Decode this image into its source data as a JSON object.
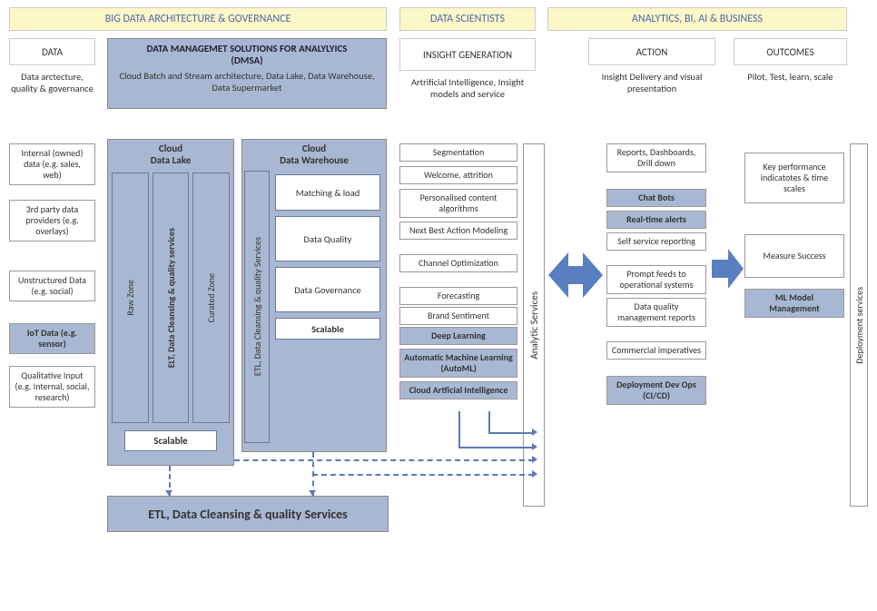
{
  "header": {
    "band1": "BIG DATA ARCHITECTURE & GOVERNANCE",
    "band2": "DATA SCIENTISTS",
    "band3": "ANALYTICS, BI, AI & BUSINESS"
  },
  "columns": {
    "data": {
      "title": "DATA",
      "subtitle": "Data arctecture, quality & governance"
    },
    "dmsa": {
      "title": "DATA MANAGEMET SOLUTIONS FOR ANALYLYICS\n(DMSA)",
      "subtitle": "Cloud Batch and Stream architecture, Data Lake, Data Warehouse, Data Supermarket"
    },
    "insight": {
      "title": "INSIGHT GENERATION",
      "subtitle": "Artrificial Intelligence, Insight models and service"
    },
    "action": {
      "title": "ACTION",
      "subtitle": "Insight Delivery and visual presentation"
    },
    "outcomes": {
      "title": "OUTCOMES",
      "subtitle": "Pilot, Test, learn, scale"
    }
  },
  "data_sources": [
    "Internal (owned) data (e.g. sales, web)",
    "3rd party data providers (e.g. overlays)",
    "Unstructured Data (e.g. social)",
    "IoT Data (e.g. sensor)",
    "Qualitative Input (e.g. Internal, social, research)"
  ],
  "cloud_data_lake": {
    "title": "Cloud\nData Lake",
    "raw_zone": "Raw Zone",
    "elt": "ELT, Data Cleansing & quality services",
    "curated": "Curated Zone",
    "scalable": "Scalable"
  },
  "cloud_dw": {
    "title": "Cloud\nData Warehouse",
    "etl": "ETL, Data Cleansing & quality Services",
    "box1": "Matching & load",
    "box2": "Data Quality",
    "box3": "Data Governance",
    "box4": "Scalable"
  },
  "insight_items": [
    "Segmentation",
    "Welcome, attrition",
    "Personalised content algorithms",
    "Next Best Action Modeling",
    "Channel Optimization",
    "Forecasting",
    "Brand Sentiment",
    "Deep Learning",
    "Automatic Machine Learning (AutoML)",
    "Cloud Artficial Intelligence"
  ],
  "analytic_services": "Analytic Services",
  "action_items": [
    "Reports, Dashboards, Drill down",
    "Chat Bots",
    "Real-time alerts",
    "Self service reporting",
    "Prompt feeds to operational systems",
    "Data quality management reports",
    "Commercial imperatives",
    "Deployment Dev Ops (CI/CD)"
  ],
  "outcome_items": [
    "Key performance indicatotes & time scales",
    "Measure Success",
    "ML Model Management"
  ],
  "etl_bar": "ETL, Data Cleansing & quality Services",
  "deployment_rail": "Deployment services"
}
